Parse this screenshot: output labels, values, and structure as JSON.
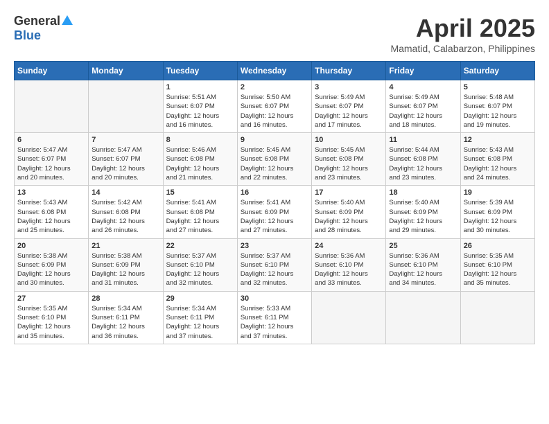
{
  "header": {
    "logo_general": "General",
    "logo_blue": "Blue",
    "title": "April 2025",
    "location": "Mamatid, Calabarzon, Philippines"
  },
  "weekdays": [
    "Sunday",
    "Monday",
    "Tuesday",
    "Wednesday",
    "Thursday",
    "Friday",
    "Saturday"
  ],
  "weeks": [
    [
      {
        "day": "",
        "info": ""
      },
      {
        "day": "",
        "info": ""
      },
      {
        "day": "1",
        "info": "Sunrise: 5:51 AM\nSunset: 6:07 PM\nDaylight: 12 hours\nand 16 minutes."
      },
      {
        "day": "2",
        "info": "Sunrise: 5:50 AM\nSunset: 6:07 PM\nDaylight: 12 hours\nand 16 minutes."
      },
      {
        "day": "3",
        "info": "Sunrise: 5:49 AM\nSunset: 6:07 PM\nDaylight: 12 hours\nand 17 minutes."
      },
      {
        "day": "4",
        "info": "Sunrise: 5:49 AM\nSunset: 6:07 PM\nDaylight: 12 hours\nand 18 minutes."
      },
      {
        "day": "5",
        "info": "Sunrise: 5:48 AM\nSunset: 6:07 PM\nDaylight: 12 hours\nand 19 minutes."
      }
    ],
    [
      {
        "day": "6",
        "info": "Sunrise: 5:47 AM\nSunset: 6:07 PM\nDaylight: 12 hours\nand 20 minutes."
      },
      {
        "day": "7",
        "info": "Sunrise: 5:47 AM\nSunset: 6:07 PM\nDaylight: 12 hours\nand 20 minutes."
      },
      {
        "day": "8",
        "info": "Sunrise: 5:46 AM\nSunset: 6:08 PM\nDaylight: 12 hours\nand 21 minutes."
      },
      {
        "day": "9",
        "info": "Sunrise: 5:45 AM\nSunset: 6:08 PM\nDaylight: 12 hours\nand 22 minutes."
      },
      {
        "day": "10",
        "info": "Sunrise: 5:45 AM\nSunset: 6:08 PM\nDaylight: 12 hours\nand 23 minutes."
      },
      {
        "day": "11",
        "info": "Sunrise: 5:44 AM\nSunset: 6:08 PM\nDaylight: 12 hours\nand 23 minutes."
      },
      {
        "day": "12",
        "info": "Sunrise: 5:43 AM\nSunset: 6:08 PM\nDaylight: 12 hours\nand 24 minutes."
      }
    ],
    [
      {
        "day": "13",
        "info": "Sunrise: 5:43 AM\nSunset: 6:08 PM\nDaylight: 12 hours\nand 25 minutes."
      },
      {
        "day": "14",
        "info": "Sunrise: 5:42 AM\nSunset: 6:08 PM\nDaylight: 12 hours\nand 26 minutes."
      },
      {
        "day": "15",
        "info": "Sunrise: 5:41 AM\nSunset: 6:08 PM\nDaylight: 12 hours\nand 27 minutes."
      },
      {
        "day": "16",
        "info": "Sunrise: 5:41 AM\nSunset: 6:09 PM\nDaylight: 12 hours\nand 27 minutes."
      },
      {
        "day": "17",
        "info": "Sunrise: 5:40 AM\nSunset: 6:09 PM\nDaylight: 12 hours\nand 28 minutes."
      },
      {
        "day": "18",
        "info": "Sunrise: 5:40 AM\nSunset: 6:09 PM\nDaylight: 12 hours\nand 29 minutes."
      },
      {
        "day": "19",
        "info": "Sunrise: 5:39 AM\nSunset: 6:09 PM\nDaylight: 12 hours\nand 30 minutes."
      }
    ],
    [
      {
        "day": "20",
        "info": "Sunrise: 5:38 AM\nSunset: 6:09 PM\nDaylight: 12 hours\nand 30 minutes."
      },
      {
        "day": "21",
        "info": "Sunrise: 5:38 AM\nSunset: 6:09 PM\nDaylight: 12 hours\nand 31 minutes."
      },
      {
        "day": "22",
        "info": "Sunrise: 5:37 AM\nSunset: 6:10 PM\nDaylight: 12 hours\nand 32 minutes."
      },
      {
        "day": "23",
        "info": "Sunrise: 5:37 AM\nSunset: 6:10 PM\nDaylight: 12 hours\nand 32 minutes."
      },
      {
        "day": "24",
        "info": "Sunrise: 5:36 AM\nSunset: 6:10 PM\nDaylight: 12 hours\nand 33 minutes."
      },
      {
        "day": "25",
        "info": "Sunrise: 5:36 AM\nSunset: 6:10 PM\nDaylight: 12 hours\nand 34 minutes."
      },
      {
        "day": "26",
        "info": "Sunrise: 5:35 AM\nSunset: 6:10 PM\nDaylight: 12 hours\nand 35 minutes."
      }
    ],
    [
      {
        "day": "27",
        "info": "Sunrise: 5:35 AM\nSunset: 6:10 PM\nDaylight: 12 hours\nand 35 minutes."
      },
      {
        "day": "28",
        "info": "Sunrise: 5:34 AM\nSunset: 6:11 PM\nDaylight: 12 hours\nand 36 minutes."
      },
      {
        "day": "29",
        "info": "Sunrise: 5:34 AM\nSunset: 6:11 PM\nDaylight: 12 hours\nand 37 minutes."
      },
      {
        "day": "30",
        "info": "Sunrise: 5:33 AM\nSunset: 6:11 PM\nDaylight: 12 hours\nand 37 minutes."
      },
      {
        "day": "",
        "info": ""
      },
      {
        "day": "",
        "info": ""
      },
      {
        "day": "",
        "info": ""
      }
    ]
  ]
}
